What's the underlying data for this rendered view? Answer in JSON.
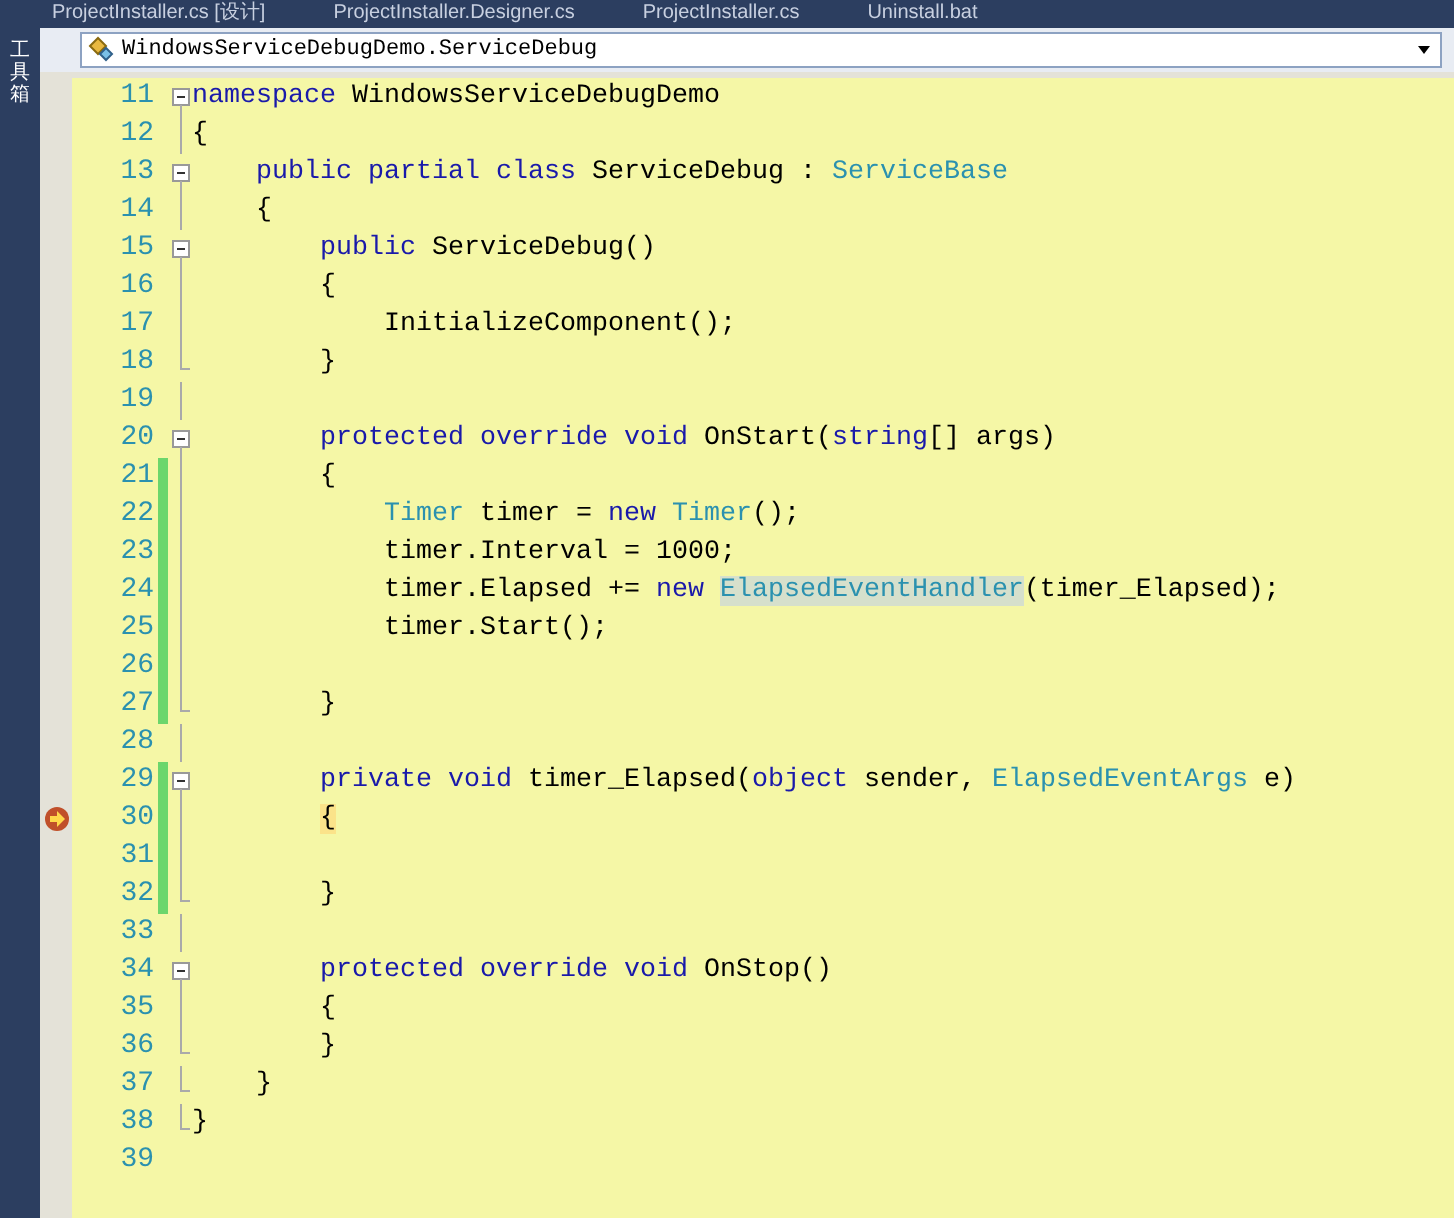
{
  "tool_strip": {
    "label": "工具箱"
  },
  "tabs": [
    {
      "label": "ProjectInstaller.cs [设计]",
      "selected": false
    },
    {
      "label": "ProjectInstaller.Designer.cs",
      "selected": false
    },
    {
      "label": "ProjectInstaller.cs",
      "selected": false
    },
    {
      "label": "Uninstall.bat",
      "selected": false
    }
  ],
  "type_dropdown": {
    "value": "WindowsServiceDebugDemo.ServiceDebug"
  },
  "lines": [
    {
      "number": "11",
      "fold_toggle": true,
      "block_end": false,
      "outlined": true,
      "changed": false,
      "current": false,
      "tokens": [
        {
          "kind": "kw",
          "text": "namespace"
        },
        {
          "kind": "plain",
          "text": " WindowsServiceDebugDemo"
        }
      ]
    },
    {
      "number": "12",
      "fold_toggle": false,
      "block_end": false,
      "outlined": true,
      "changed": false,
      "current": false,
      "tokens": [
        {
          "kind": "plain",
          "text": "{"
        }
      ]
    },
    {
      "number": "13",
      "fold_toggle": true,
      "block_end": false,
      "outlined": true,
      "changed": false,
      "current": false,
      "tokens": [
        {
          "kind": "kw",
          "text": "    public"
        },
        {
          "kind": "kw",
          "text": " partial"
        },
        {
          "kind": "kw",
          "text": " class"
        },
        {
          "kind": "plain",
          "text": " ServiceDebug : "
        },
        {
          "kind": "type",
          "text": "ServiceBase"
        }
      ]
    },
    {
      "number": "14",
      "fold_toggle": false,
      "block_end": false,
      "outlined": true,
      "changed": false,
      "current": false,
      "tokens": [
        {
          "kind": "plain",
          "text": "    {"
        }
      ]
    },
    {
      "number": "15",
      "fold_toggle": true,
      "block_end": false,
      "outlined": true,
      "changed": false,
      "current": false,
      "tokens": [
        {
          "kind": "kw",
          "text": "        public"
        },
        {
          "kind": "plain",
          "text": " ServiceDebug()"
        }
      ]
    },
    {
      "number": "16",
      "fold_toggle": false,
      "block_end": false,
      "outlined": true,
      "changed": false,
      "current": false,
      "tokens": [
        {
          "kind": "plain",
          "text": "        {"
        }
      ]
    },
    {
      "number": "17",
      "fold_toggle": false,
      "block_end": false,
      "outlined": true,
      "changed": false,
      "current": false,
      "tokens": [
        {
          "kind": "plain",
          "text": "            InitializeComponent();"
        }
      ]
    },
    {
      "number": "18",
      "fold_toggle": false,
      "block_end": true,
      "outlined": true,
      "changed": false,
      "current": false,
      "tokens": [
        {
          "kind": "plain",
          "text": "        }"
        }
      ]
    },
    {
      "number": "19",
      "fold_toggle": false,
      "block_end": false,
      "outlined": true,
      "changed": false,
      "current": false
    },
    {
      "number": "20",
      "fold_toggle": true,
      "block_end": false,
      "outlined": true,
      "changed": false,
      "current": false,
      "tokens": [
        {
          "kind": "kw",
          "text": "        protected"
        },
        {
          "kind": "kw",
          "text": " override"
        },
        {
          "kind": "kw",
          "text": " void"
        },
        {
          "kind": "plain",
          "text": " OnStart("
        },
        {
          "kind": "kw",
          "text": "string"
        },
        {
          "kind": "plain",
          "text": "[] args)"
        }
      ]
    },
    {
      "number": "21",
      "fold_toggle": false,
      "block_end": false,
      "outlined": true,
      "changed": true,
      "current": false,
      "tokens": [
        {
          "kind": "plain",
          "text": "        {"
        }
      ]
    },
    {
      "number": "22",
      "fold_toggle": false,
      "block_end": false,
      "outlined": true,
      "changed": true,
      "current": false,
      "tokens": [
        {
          "kind": "type",
          "text": "            Timer"
        },
        {
          "kind": "plain",
          "text": " timer = "
        },
        {
          "kind": "kw",
          "text": "new"
        },
        {
          "kind": "type",
          "text": " Timer"
        },
        {
          "kind": "plain",
          "text": "();"
        }
      ]
    },
    {
      "number": "23",
      "fold_toggle": false,
      "block_end": false,
      "outlined": true,
      "changed": true,
      "current": false,
      "tokens": [
        {
          "kind": "plain",
          "text": "            timer.Interval = 1000;"
        }
      ]
    },
    {
      "number": "24",
      "fold_toggle": false,
      "block_end": false,
      "outlined": true,
      "changed": true,
      "current": false,
      "tokens": [
        {
          "kind": "plain",
          "text": "            timer.Elapsed += "
        },
        {
          "kind": "kw",
          "text": "new"
        },
        {
          "kind": "type",
          "text": " ElapsedEventHandler",
          "highlighted": true
        },
        {
          "kind": "plain",
          "text": "(timer_Elapsed);"
        }
      ]
    },
    {
      "number": "25",
      "fold_toggle": false,
      "block_end": false,
      "outlined": true,
      "changed": true,
      "current": false,
      "tokens": [
        {
          "kind": "plain",
          "text": "            timer.Start();"
        }
      ]
    },
    {
      "number": "26",
      "fold_toggle": false,
      "block_end": false,
      "outlined": true,
      "changed": true,
      "current": false
    },
    {
      "number": "27",
      "fold_toggle": false,
      "block_end": true,
      "outlined": true,
      "changed": true,
      "current": false,
      "tokens": [
        {
          "kind": "plain",
          "text": "        }"
        }
      ]
    },
    {
      "number": "28",
      "fold_toggle": false,
      "block_end": false,
      "outlined": true,
      "changed": false,
      "current": false
    },
    {
      "number": "29",
      "fold_toggle": true,
      "block_end": false,
      "outlined": true,
      "changed": true,
      "current": false,
      "tokens": [
        {
          "kind": "kw",
          "text": "        private"
        },
        {
          "kind": "kw",
          "text": " void"
        },
        {
          "kind": "plain",
          "text": " timer_Elapsed("
        },
        {
          "kind": "kw",
          "text": "object"
        },
        {
          "kind": "plain",
          "text": " sender, "
        },
        {
          "kind": "type",
          "text": "ElapsedEventArgs"
        },
        {
          "kind": "plain",
          "text": " e)"
        }
      ]
    },
    {
      "number": "30",
      "fold_toggle": false,
      "block_end": false,
      "outlined": true,
      "changed": true,
      "current": true,
      "tokens": [
        {
          "kind": "plain",
          "text": "        {",
          "highlighted": true
        }
      ]
    },
    {
      "number": "31",
      "fold_toggle": false,
      "block_end": false,
      "outlined": true,
      "changed": true,
      "current": false
    },
    {
      "number": "32",
      "fold_toggle": false,
      "block_end": true,
      "outlined": true,
      "changed": true,
      "current": false,
      "tokens": [
        {
          "kind": "plain",
          "text": "        }"
        }
      ]
    },
    {
      "number": "33",
      "fold_toggle": false,
      "block_end": false,
      "outlined": true,
      "changed": false,
      "current": false
    },
    {
      "number": "34",
      "fold_toggle": true,
      "block_end": false,
      "outlined": true,
      "changed": false,
      "current": false,
      "tokens": [
        {
          "kind": "kw",
          "text": "        protected"
        },
        {
          "kind": "kw",
          "text": " override"
        },
        {
          "kind": "kw",
          "text": " void"
        },
        {
          "kind": "plain",
          "text": " OnStop()"
        }
      ]
    },
    {
      "number": "35",
      "fold_toggle": false,
      "block_end": false,
      "outlined": true,
      "changed": false,
      "current": false,
      "tokens": [
        {
          "kind": "plain",
          "text": "        {"
        }
      ]
    },
    {
      "number": "36",
      "fold_toggle": false,
      "block_end": true,
      "outlined": true,
      "changed": false,
      "current": false,
      "tokens": [
        {
          "kind": "plain",
          "text": "        }"
        }
      ]
    },
    {
      "number": "37",
      "fold_toggle": false,
      "block_end": true,
      "outlined": true,
      "changed": false,
      "current": false,
      "tokens": [
        {
          "kind": "plain",
          "text": "    }"
        }
      ]
    },
    {
      "number": "38",
      "fold_toggle": false,
      "block_end": true,
      "outlined": true,
      "changed": false,
      "current": false,
      "tokens": [
        {
          "kind": "plain",
          "text": "}"
        }
      ]
    },
    {
      "number": "39",
      "fold_toggle": false,
      "block_end": false,
      "outlined": false,
      "changed": false,
      "current": false
    }
  ]
}
